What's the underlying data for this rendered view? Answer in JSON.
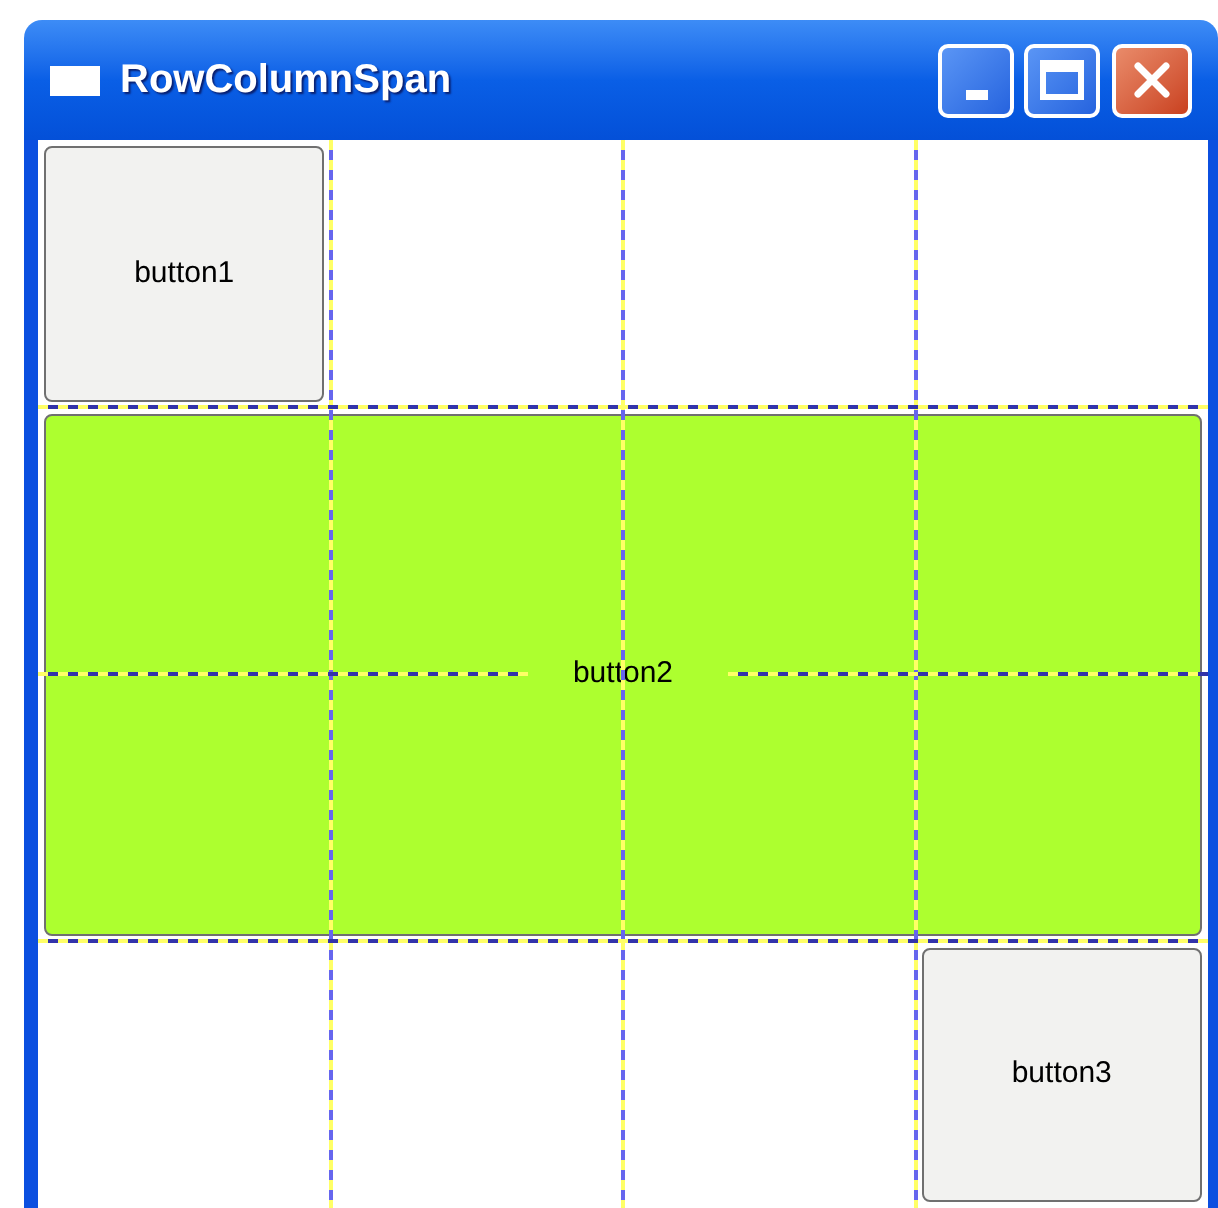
{
  "window": {
    "title": "RowColumnSpan"
  },
  "buttons": [
    {
      "label": "button1",
      "color": "#f2f2f0"
    },
    {
      "label": "button2",
      "color": "#adff2f"
    },
    {
      "label": "button3",
      "color": "#f2f2f0"
    }
  ]
}
